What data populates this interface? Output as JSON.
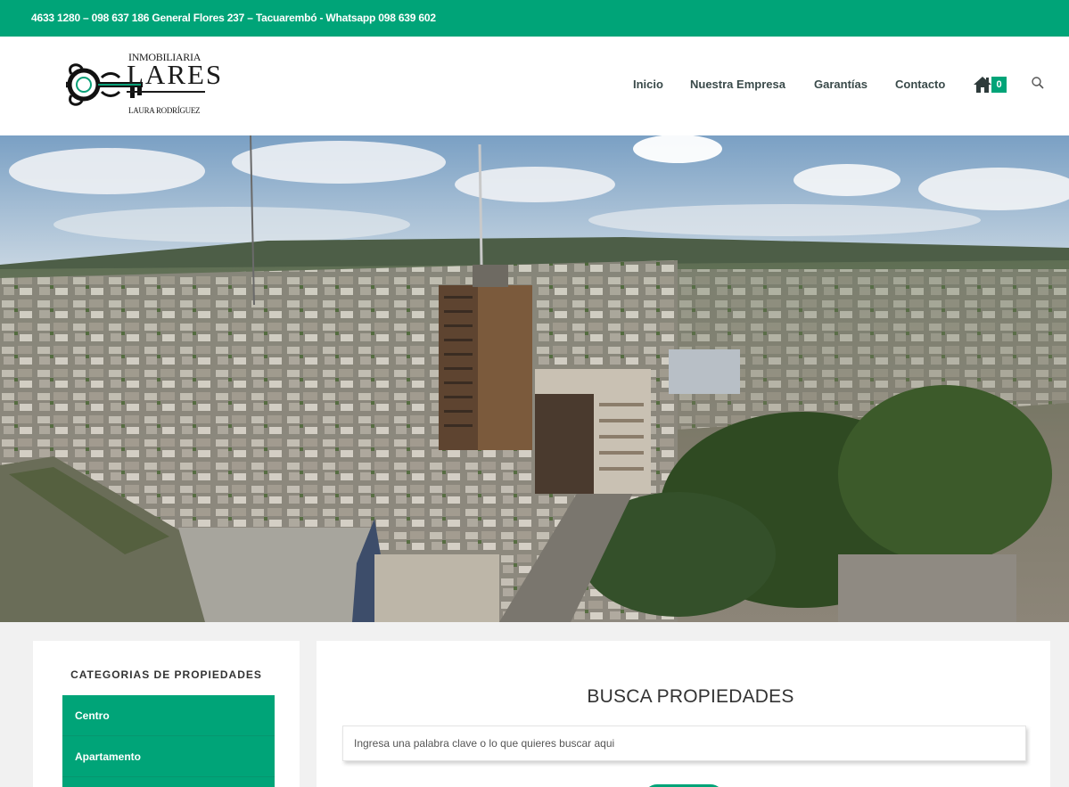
{
  "topbar": {
    "contact_text": "4633 1280 – 098 637 186 General Flores 237 – Tacuarembó - Whatsapp 098 639 602"
  },
  "logo": {
    "top_text": "INMOBILIARIA",
    "main_text": "LARES",
    "sub_text": "LAURA RODRÍGUEZ"
  },
  "nav": {
    "items": [
      {
        "label": "Inicio"
      },
      {
        "label": "Nuestra Empresa"
      },
      {
        "label": "Garantías"
      },
      {
        "label": "Contacto"
      }
    ],
    "cart_count": "0"
  },
  "sidebar": {
    "title": "CATEGORIAS DE PROPIEDADES",
    "categories": [
      {
        "label": "Centro"
      },
      {
        "label": "Apartamento"
      },
      {
        "label": ""
      }
    ]
  },
  "main": {
    "title": "BUSCA PROPIEDADES",
    "search_placeholder": "Ingresa una palabra clave o lo que quieres buscar aqui"
  },
  "icons": {
    "home": "home-icon",
    "search": "search-icon",
    "key": "key-icon"
  },
  "colors": {
    "brand_green": "#00a478",
    "nav_text": "#3a4a4a"
  }
}
